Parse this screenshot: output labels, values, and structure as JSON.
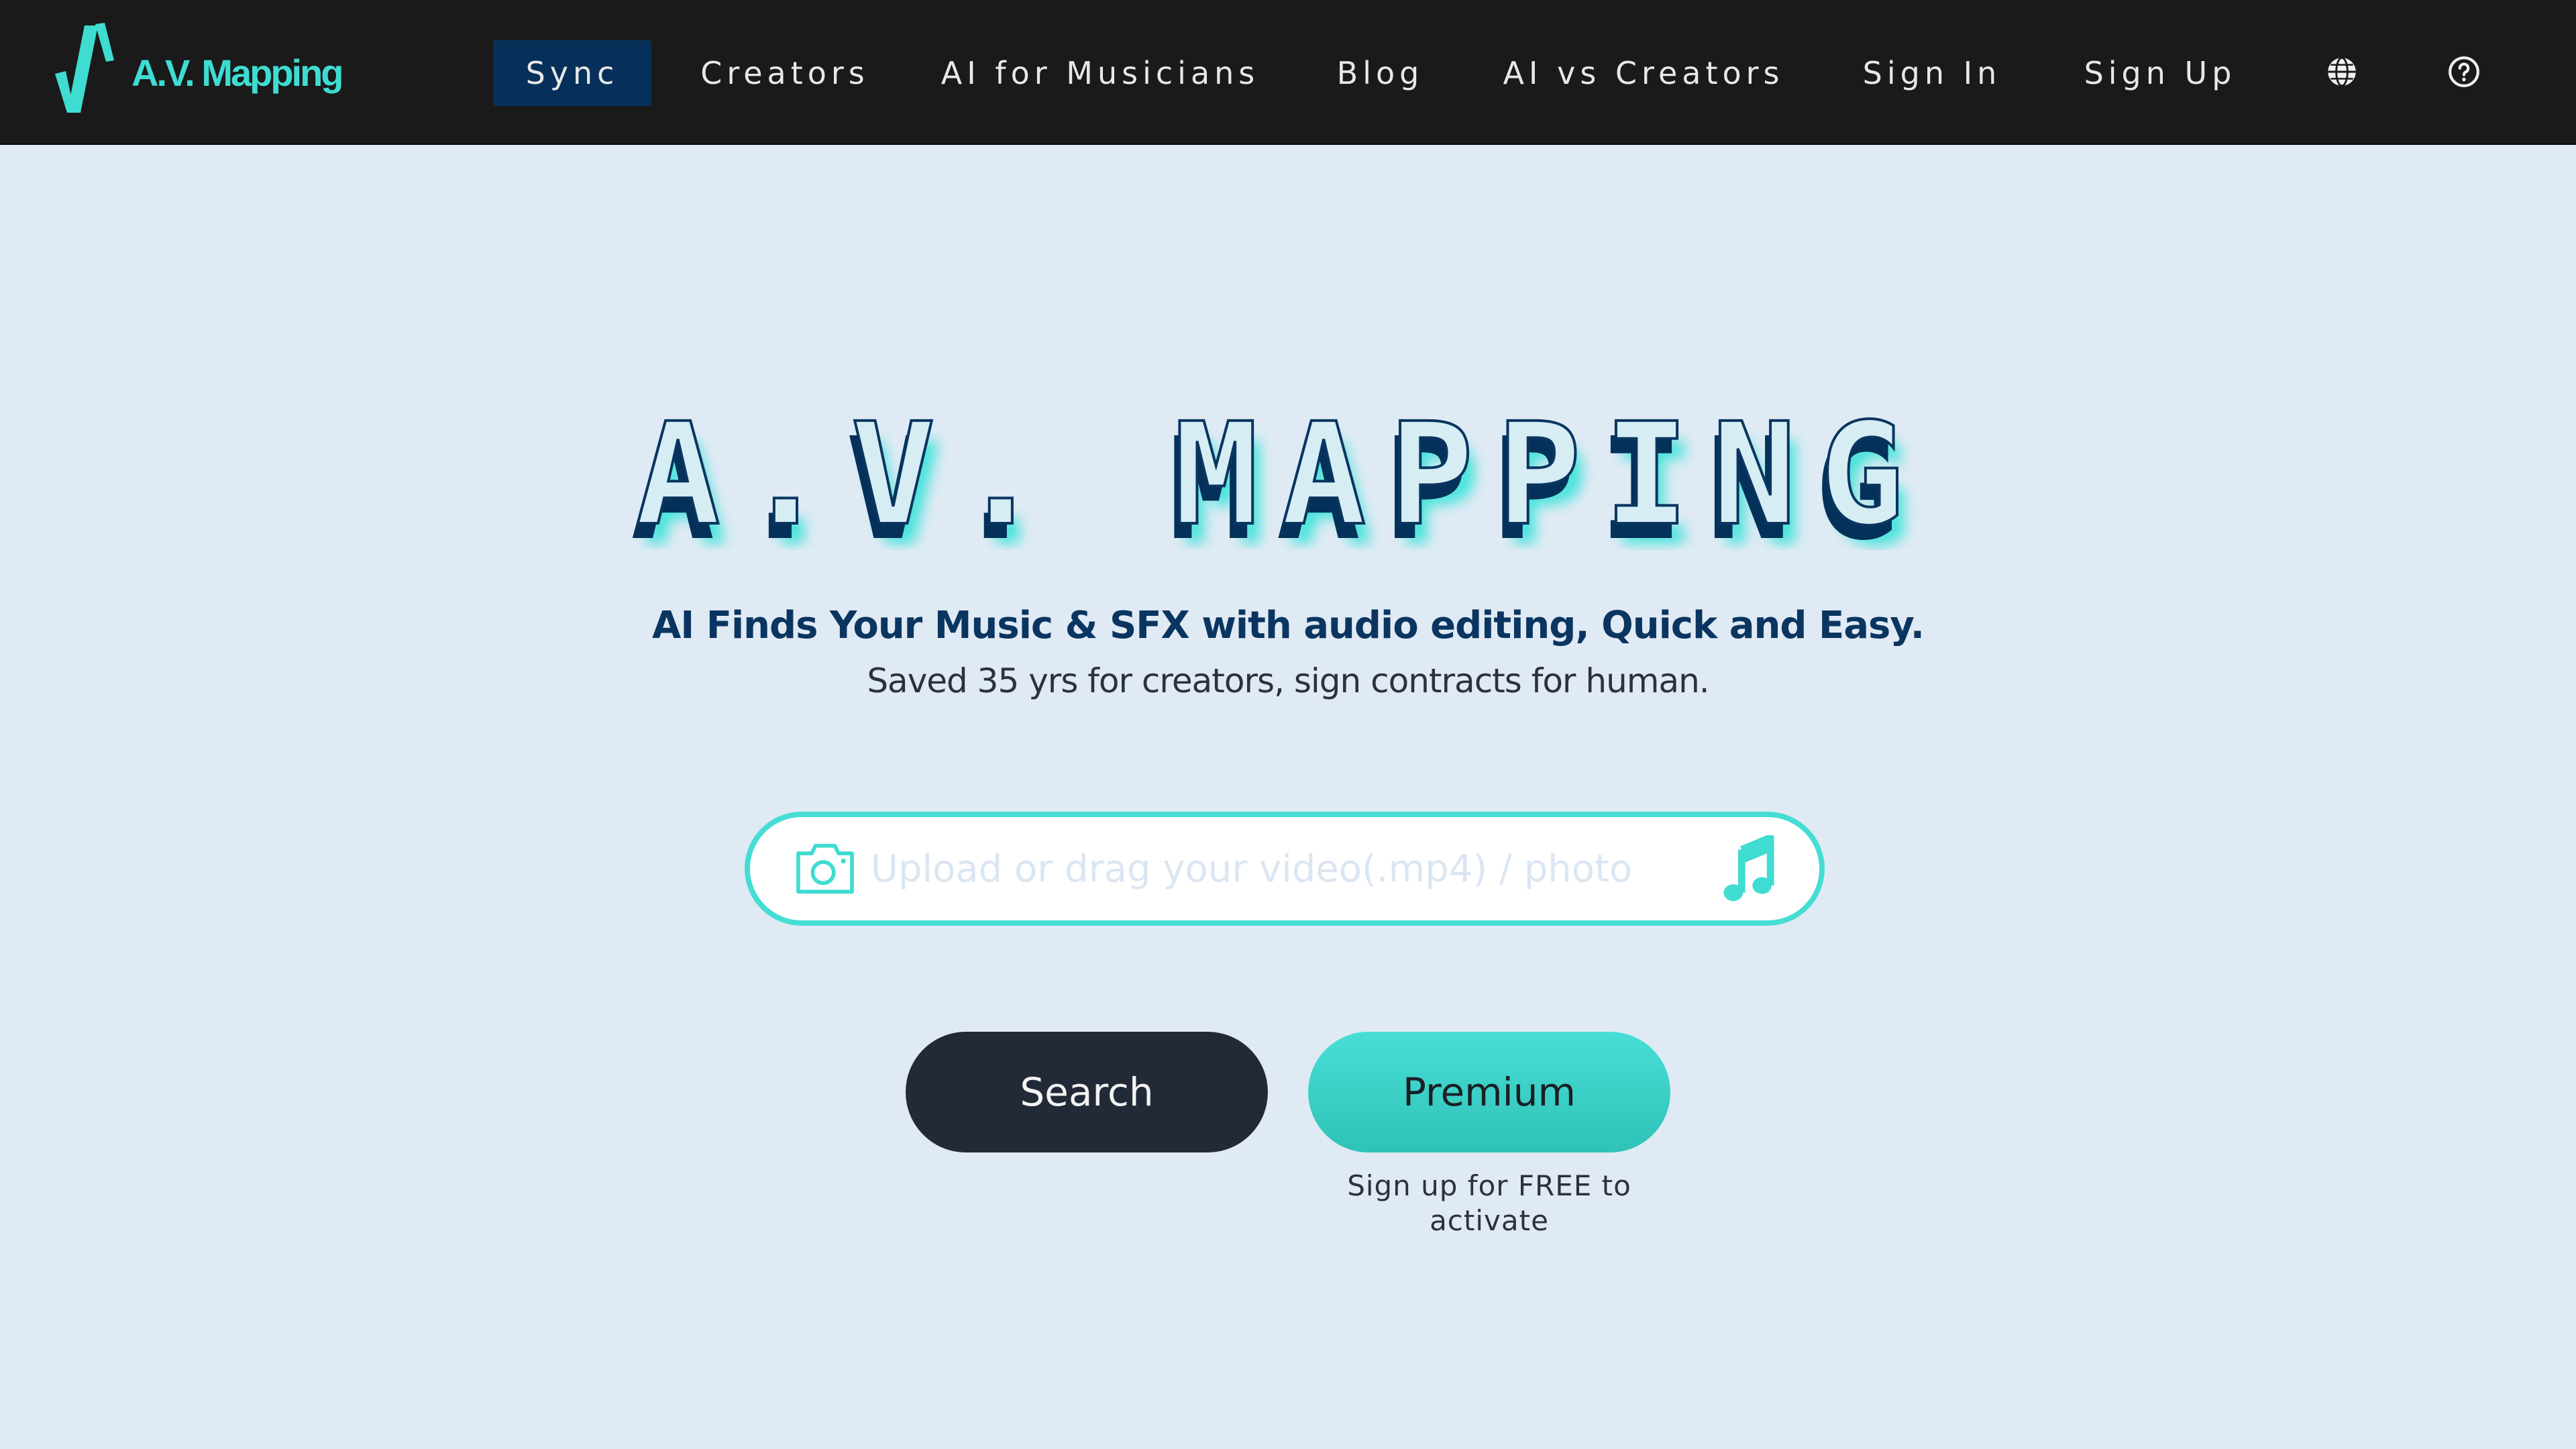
{
  "brand": {
    "name": "A.V. Mapping",
    "logo_icon": "av-mapping-logo-icon",
    "accent_color": "#3fdcd2"
  },
  "nav": {
    "items": [
      {
        "label": "Sync",
        "active": true
      },
      {
        "label": "Creators",
        "active": false
      },
      {
        "label": "AI for Musicians",
        "active": false
      },
      {
        "label": "Blog",
        "active": false
      },
      {
        "label": "AI vs Creators",
        "active": false
      },
      {
        "label": "Sign In",
        "active": false
      },
      {
        "label": "Sign Up",
        "active": false
      }
    ],
    "icons": [
      "globe-icon",
      "help-icon"
    ]
  },
  "hero": {
    "title": "A.V. MAPPING",
    "tagline": "AI Finds Your Music & SFX with audio editing, Quick and Easy.",
    "subline": "Saved 35 yrs for creators, sign contracts for human."
  },
  "upload": {
    "value": "",
    "placeholder": "Upload or drag your video(.mp4) / photo",
    "left_icon": "camera-icon",
    "right_icon": "music-note-icon"
  },
  "actions": {
    "search_label": "Search",
    "premium_label": "Premium",
    "premium_note": "Sign up for FREE to activate"
  },
  "colors": {
    "nav_bg": "#1a1a1a",
    "active_tab_bg": "#06305a",
    "page_bg": "#e0eaf4",
    "teal": "#45ddd4",
    "navy": "#0a3560",
    "search_button_bg": "#222a38"
  }
}
